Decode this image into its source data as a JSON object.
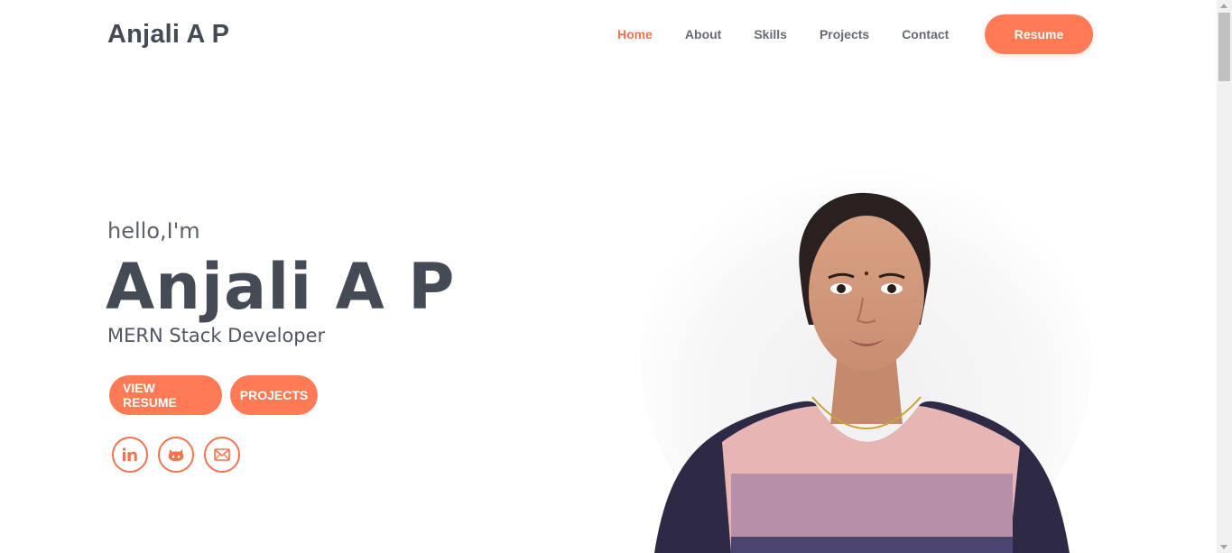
{
  "nav": {
    "brand": "Anjali A P",
    "links": [
      {
        "label": "Home",
        "active": true
      },
      {
        "label": "About",
        "active": false
      },
      {
        "label": "Skills",
        "active": false
      },
      {
        "label": "Projects",
        "active": false
      },
      {
        "label": "Contact",
        "active": false
      }
    ],
    "resume_label": "Resume"
  },
  "hero": {
    "greeting": "hello,I'm",
    "name": "Anjali A P",
    "role": "MERN Stack Developer",
    "buttons": {
      "view_resume": "VIEW RESUME",
      "projects": "PROJECTS"
    },
    "socials": [
      {
        "icon": "linkedin-icon"
      },
      {
        "icon": "github-icon"
      },
      {
        "icon": "mail-icon"
      }
    ]
  },
  "theme": {
    "accent": "#ff7a55",
    "text_dark": "#454b54"
  }
}
